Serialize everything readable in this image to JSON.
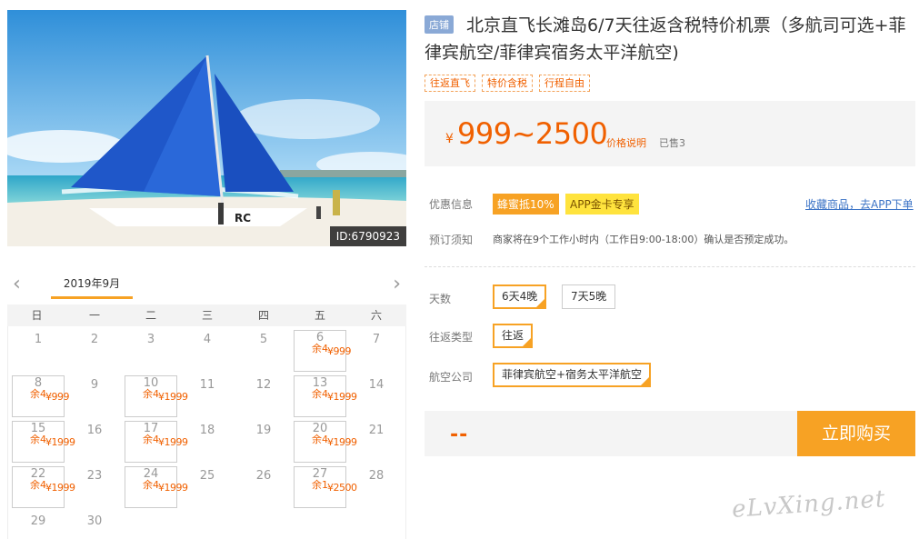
{
  "photo": {
    "id_label": "ID:6790923",
    "boat_text": "RC"
  },
  "calendar": {
    "month": "2019年9月",
    "prev": "‹",
    "next": "›",
    "weekdays": [
      "日",
      "一",
      "二",
      "三",
      "四",
      "五",
      "六"
    ],
    "days": [
      {
        "n": "1"
      },
      {
        "n": "2"
      },
      {
        "n": "3"
      },
      {
        "n": "4"
      },
      {
        "n": "5"
      },
      {
        "n": "6",
        "price": "¥999",
        "rest": "余4"
      },
      {
        "n": "7"
      },
      {
        "n": "8",
        "price": "¥999",
        "rest": "余4"
      },
      {
        "n": "9"
      },
      {
        "n": "10",
        "price": "¥1999",
        "rest": "余4"
      },
      {
        "n": "11"
      },
      {
        "n": "12"
      },
      {
        "n": "13",
        "price": "¥1999",
        "rest": "余4"
      },
      {
        "n": "14"
      },
      {
        "n": "15",
        "price": "¥1999",
        "rest": "余4"
      },
      {
        "n": "16"
      },
      {
        "n": "17",
        "price": "¥1999",
        "rest": "余4"
      },
      {
        "n": "18"
      },
      {
        "n": "19"
      },
      {
        "n": "20",
        "price": "¥1999",
        "rest": "余4"
      },
      {
        "n": "21"
      },
      {
        "n": "22",
        "price": "¥1999",
        "rest": "余4"
      },
      {
        "n": "23"
      },
      {
        "n": "24",
        "price": "¥1999",
        "rest": "余4"
      },
      {
        "n": "25"
      },
      {
        "n": "26"
      },
      {
        "n": "27",
        "price": "¥2500",
        "rest": "余1"
      },
      {
        "n": "28"
      },
      {
        "n": "29"
      },
      {
        "n": "30"
      }
    ]
  },
  "product": {
    "shop_badge": "店铺",
    "title": "北京直飞长滩岛6/7天往返含税特价机票（多航司可选+菲律宾航空/菲律宾宿务太平洋航空)",
    "tags": [
      "往返直飞",
      "特价含税",
      "行程自由"
    ],
    "yen": "¥",
    "price": "999~2500",
    "price_note": "价格说明",
    "sold": "已售3"
  },
  "promo": {
    "label": "优惠信息",
    "badge1": "蜂蜜抵10%",
    "badge2": "APP金卡专享",
    "fav_link": "收藏商品，去APP下单"
  },
  "notice": {
    "label": "预订须知",
    "text": "商家将在9个工作小时内（工作日9:00-18:00）确认是否预定成功。"
  },
  "options": {
    "days_label": "天数",
    "days": [
      "6天4晚",
      "7天5晚"
    ],
    "type_label": "往返类型",
    "type": "往返",
    "airline_label": "航空公司",
    "airline": "菲律宾航空+宿务太平洋航空"
  },
  "buy": {
    "total": "--",
    "button": "立即购买"
  },
  "watermark": "eLvXing.net",
  "colors": {
    "accent": "#f7a224",
    "price": "#f06000",
    "link": "#3b73c6"
  }
}
